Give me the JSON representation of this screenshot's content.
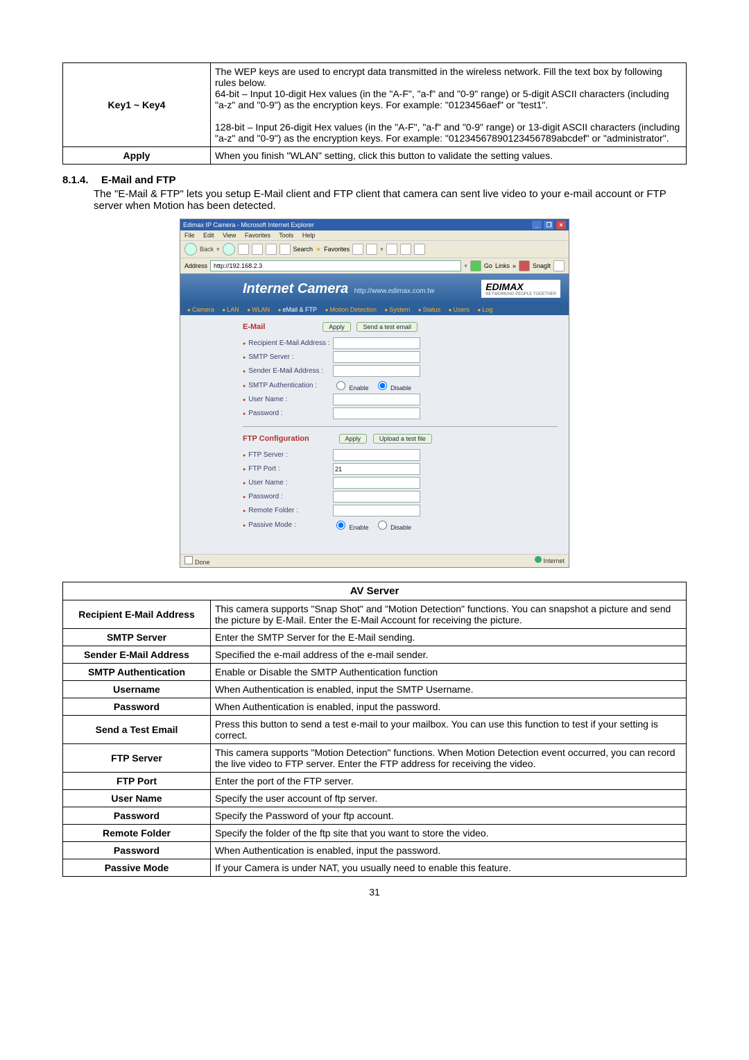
{
  "top_table": {
    "rows": [
      {
        "label": "Key1 ~ Key4",
        "text": "The WEP keys are used to encrypt data transmitted in the wireless network. Fill the text box by following rules below.\n64-bit – Input 10-digit Hex values (in the \"A-F\", \"a-f\" and \"0-9\" range) or 5-digit ASCII characters (including \"a-z\" and \"0-9\") as the encryption keys. For example: \"0123456aef\" or \"test1\".\n\n128-bit – Input 26-digit Hex values (in the \"A-F\", \"a-f\" and \"0-9\" range) or 13-digit ASCII characters (including \"a-z\" and \"0-9\") as the encryption keys. For example: \"01234567890123456789abcdef\" or \"administrator\"."
      },
      {
        "label": "Apply",
        "text": "When you finish \"WLAN\" setting, click this button to validate the setting values."
      }
    ]
  },
  "section": {
    "number": "8.1.4.",
    "title": "E-Mail and FTP",
    "body": "The \"E-Mail & FTP\" lets you setup E-Mail client and FTP client that camera can sent live video to your e-mail account or FTP server when Motion has been detected."
  },
  "browser": {
    "window_title": "Edimax IP Camera - Microsoft Internet Explorer",
    "menus": [
      "File",
      "Edit",
      "View",
      "Favorites",
      "Tools",
      "Help"
    ],
    "toolbar": {
      "search": "Search",
      "favorites": "Favorites"
    },
    "address_label": "Address",
    "address_value": "http://192.168.2.3",
    "go_label": "Go",
    "links_label": "Links",
    "snagit_label": "SnagIt",
    "banner_title": "Internet Camera",
    "banner_url": "http://www.edimax.com.tw",
    "brand": "EDIMAX",
    "brand_sub": "NETWORKING PEOPLE TOGETHER",
    "tabs": [
      "Camera",
      "LAN",
      "WLAN",
      "eMail & FTP",
      "Motion Detection",
      "System",
      "Status",
      "Users",
      "Log"
    ],
    "sel_tab": "eMail & FTP",
    "email_head": "E-Mail",
    "email_apply": "Apply",
    "email_test": "Send a test email",
    "email_fields": {
      "recipient": "Recipient E-Mail Address :",
      "smtp": "SMTP Server :",
      "sender": "Sender E-Mail Address :",
      "auth": "SMTP Authentication :",
      "user": "User Name :",
      "pass": "Password :"
    },
    "radio_enable": "Enable",
    "radio_disable": "Disable",
    "ftp_head": "FTP Configuration",
    "ftp_apply": "Apply",
    "ftp_test": "Upload a test file",
    "ftp_fields": {
      "server": "FTP Server :",
      "port": "FTP Port :",
      "user": "User Name :",
      "pass": "Password :",
      "folder": "Remote Folder :",
      "passive": "Passive Mode :"
    },
    "ftp_port_value": "21",
    "status_done": "Done",
    "status_zone": "Internet"
  },
  "av_table": {
    "header": "AV Server",
    "rows": [
      {
        "label": "Recipient E-Mail Address",
        "text": "This camera supports \"Snap Shot\" and \"Motion Detection\" functions. You can snapshot a picture and send the picture by E-Mail. Enter the E-Mail Account for receiving the picture."
      },
      {
        "label": "SMTP Server",
        "text": "Enter the SMTP Server for the E-Mail sending."
      },
      {
        "label": "Sender E-Mail Address",
        "text": "Specified the e-mail address of the e-mail sender."
      },
      {
        "label": "SMTP Authentication",
        "text": "Enable or Disable the SMTP Authentication function"
      },
      {
        "label": "Username",
        "text": "When Authentication is enabled, input the SMTP Username."
      },
      {
        "label": "Password",
        "text": "When Authentication is enabled, input the password."
      },
      {
        "label": "Send a Test Email",
        "text": "Press this button to send a test e-mail to your mailbox. You can use this function to test if your setting is correct."
      },
      {
        "label": "FTP Server",
        "text": "This camera supports \"Motion Detection\" functions. When Motion Detection event occurred, you can record the live video to FTP server. Enter the FTP address for receiving the video."
      },
      {
        "label": "FTP Port",
        "text": "Enter the port of the FTP server."
      },
      {
        "label": "User Name",
        "text": "Specify the user account of ftp server."
      },
      {
        "label": "Password",
        "text": "Specify the Password of your ftp account."
      },
      {
        "label": "Remote Folder",
        "text": "Specify the folder of the ftp site that you want to store the video."
      },
      {
        "label": "Password",
        "text": "When Authentication is enabled, input the password."
      },
      {
        "label": "Passive Mode",
        "text": "If your Camera is under NAT, you usually need to enable this feature."
      }
    ]
  },
  "page_number": "31"
}
